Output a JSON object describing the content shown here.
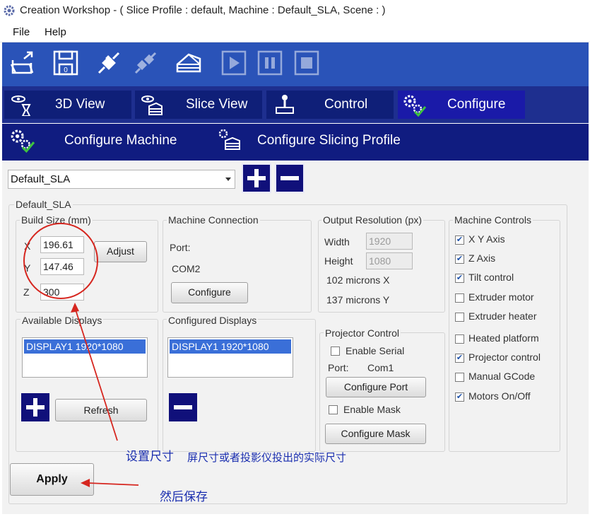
{
  "window": {
    "title": "Creation Workshop -   ( Slice Profile : default, Machine : Default_SLA, Scene : )"
  },
  "menu": [
    "File",
    "Help"
  ],
  "toolbar": {
    "icons": [
      "open-file-icon",
      "save-icon",
      "connect-icon",
      "disconnect-icon",
      "slice-icon",
      "play-icon",
      "pause-icon",
      "stop-icon"
    ]
  },
  "tabs": [
    {
      "label": "3D View",
      "icon": "eye-icon"
    },
    {
      "label": "Slice View",
      "icon": "slice-view-icon"
    },
    {
      "label": "Control",
      "icon": "joystick-icon"
    },
    {
      "label": "Configure",
      "icon": "gears-icon"
    }
  ],
  "subtabs": [
    {
      "label": "Configure Machine",
      "icon": "gears-icon"
    },
    {
      "label": "Configure Slicing Profile",
      "icon": "slice-profile-icon"
    }
  ],
  "machine_select": {
    "value": "Default_SLA"
  },
  "machine_group": {
    "label": "Default_SLA"
  },
  "build_size": {
    "label": "Build Size (mm)",
    "x_label": "X",
    "x_value": "196.61",
    "y_label": "Y",
    "y_value": "147.46",
    "z_label": "Z",
    "z_value": "300",
    "adjust": "Adjust"
  },
  "machine_connection": {
    "label": "Machine Connection",
    "port_label": "Port:",
    "port_value": "COM2",
    "configure": "Configure"
  },
  "output_resolution": {
    "label": "Output Resolution (px)",
    "width_label": "Width",
    "width_value": "1920",
    "height_label": "Height",
    "height_value": "1080",
    "x_microns": "102 microns X",
    "y_microns": "137 microns Y"
  },
  "machine_controls": {
    "label": "Machine Controls",
    "items": [
      {
        "label": "X Y Axis",
        "checked": true
      },
      {
        "label": "Z Axis",
        "checked": true
      },
      {
        "label": "Tilt control",
        "checked": true
      },
      {
        "label": "Extruder motor",
        "checked": false
      },
      {
        "label": "Extruder heater",
        "checked": false
      },
      {
        "label": "Heated platform",
        "checked": false
      },
      {
        "label": "Projector control",
        "checked": true
      },
      {
        "label": "Manual GCode",
        "checked": false
      },
      {
        "label": "Motors On/Off",
        "checked": true
      }
    ]
  },
  "available_displays": {
    "label": "Available Displays",
    "items": [
      "DISPLAY1 1920*1080"
    ],
    "refresh": "Refresh"
  },
  "configured_displays": {
    "label": "Configured Displays",
    "items": [
      "DISPLAY1 1920*1080"
    ]
  },
  "projector_control": {
    "label": "Projector Control",
    "enable_serial": "Enable Serial",
    "port_label": "Port:",
    "port_value": "Com1",
    "configure_port": "Configure Port",
    "enable_mask": "Enable Mask",
    "configure_mask": "Configure Mask"
  },
  "apply": "Apply",
  "annotations": {
    "set_size": "设置尺寸",
    "screen_size": "屏尺寸或者投影仪投出的实际尺寸",
    "then_save": "然后保存"
  },
  "colors": {
    "toolbar": "#2a53b8",
    "tabs": "#1e2f8f",
    "accent_red": "#d6261f",
    "annotation_blue": "#1a2eaf"
  }
}
